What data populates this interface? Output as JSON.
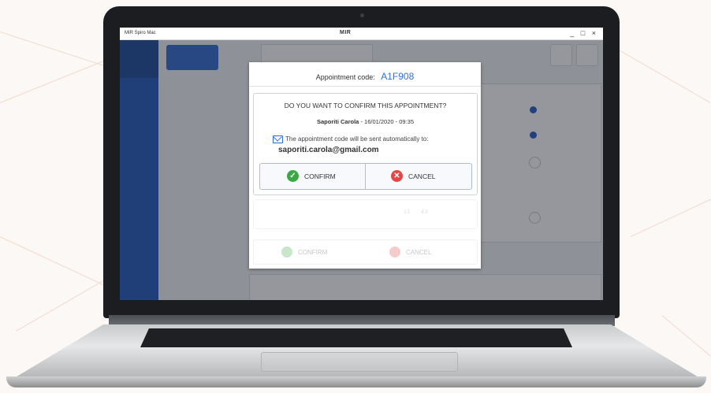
{
  "window": {
    "app_name": "MIR Spiro Mac",
    "brand": "MIR",
    "controls": "_ □ ×"
  },
  "dialog": {
    "appointment_label": "Appointment code:",
    "appointment_code": "A1F908",
    "question": "DO YOU WANT TO CONFIRM THIS APPOINTMENT?",
    "patient_name": "Saporiti Carola",
    "patient_datetime": " - 16/01/2020 - 09:35",
    "email_note": "The appointment code will be sent automatically to:",
    "email": "saporiti.carola@gmail.com",
    "confirm_label": "CONFIRM",
    "cancel_label": "CANCEL",
    "faded_confirm_label": "CONFIRM",
    "faded_cancel_label": "CANCEL",
    "faded_hour": "11",
    "faded_minute": "43"
  },
  "colors": {
    "accent_blue": "#2f6fd6",
    "confirm_green": "#3aa845",
    "cancel_red": "#e04848",
    "nav_blue": "#2a5fbe"
  },
  "icons": {
    "confirm": "check-circle-icon",
    "cancel": "x-circle-icon",
    "email": "envelope-icon"
  }
}
